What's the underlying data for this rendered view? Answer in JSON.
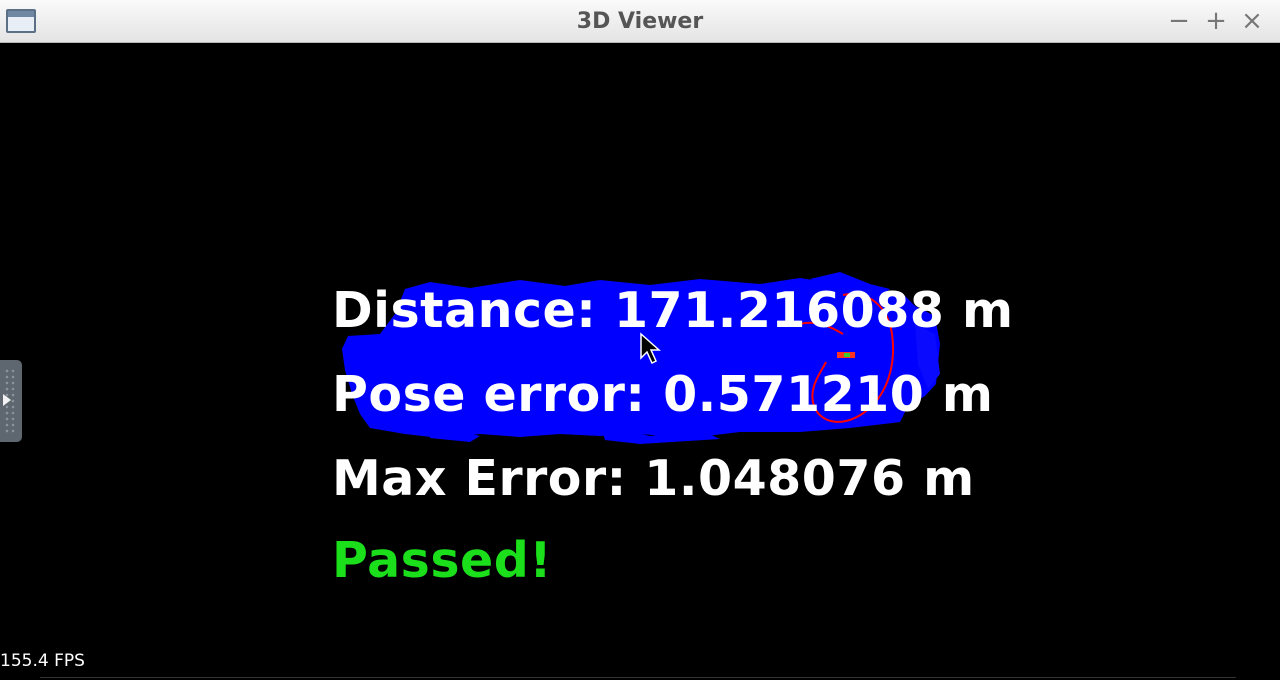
{
  "window": {
    "title": "3D Viewer",
    "controls": {
      "minimize": "−",
      "maximize": "+",
      "close": "×"
    }
  },
  "viewport": {
    "lines": {
      "distance": "Distance: 171.216088 m",
      "pose_error": "Pose error: 0.571210 m",
      "max_error": "Max Error: 1.048076 m",
      "status": "Passed!"
    },
    "fps": "155.4 FPS",
    "colors": {
      "map_points": "#0000ff",
      "trajectory": "#ff0000",
      "passed_text": "#1adf1a",
      "text": "#ffffff",
      "background": "#000000"
    }
  }
}
